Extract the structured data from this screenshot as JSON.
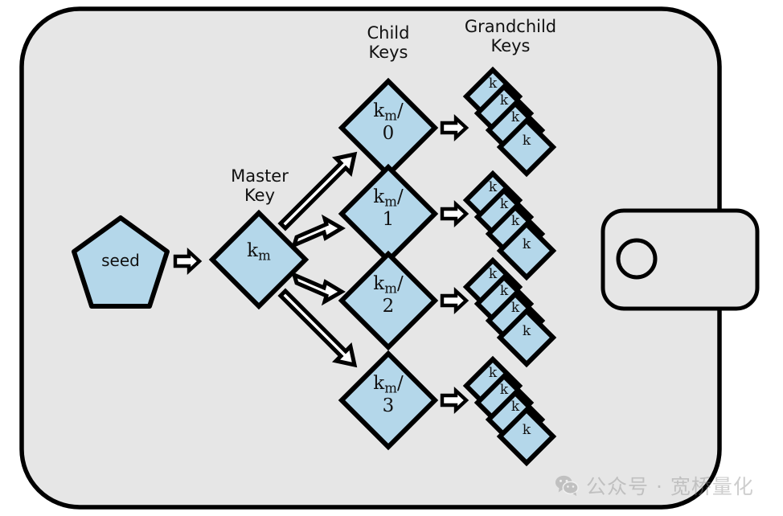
{
  "figure": {
    "background_color": "#ffffff",
    "panel_color": "#e6e6e6",
    "shape_fill": "#b4d7ea",
    "stroke_color": "#000000",
    "text_color": "#111111"
  },
  "headings": {
    "child_keys": "Child\nKeys",
    "grandchild_keys": "Grandchild\nKeys",
    "master_key": "Master\nKey"
  },
  "seed": {
    "label": "seed",
    "shape": "pentagon"
  },
  "master_key": {
    "base": "k",
    "subscript": "m",
    "shape": "diamond"
  },
  "child_keys": [
    {
      "base": "k",
      "subscript": "m",
      "suffix": "/",
      "index": "0",
      "shape": "diamond"
    },
    {
      "base": "k",
      "subscript": "m",
      "suffix": "/",
      "index": "1",
      "shape": "diamond"
    },
    {
      "base": "k",
      "subscript": "m",
      "suffix": "/",
      "index": "2",
      "shape": "diamond"
    },
    {
      "base": "k",
      "subscript": "m",
      "suffix": "/",
      "index": "3",
      "shape": "diamond"
    }
  ],
  "grandchild_stacks": [
    {
      "label": "k",
      "count": 4
    },
    {
      "label": "k",
      "count": 4
    },
    {
      "label": "k",
      "count": 4
    },
    {
      "label": "k",
      "count": 4
    }
  ],
  "arrows": {
    "seed_to_master": "block-arrow-right",
    "master_to_child": "block-arrow-diagonal",
    "child_to_grandchild": "block-arrow-right"
  },
  "side_panel": {
    "shape": "rounded-rectangle",
    "knob": "circle"
  },
  "watermark": {
    "icon": "wechat-icon",
    "text": "公众号 · 宽桥量化"
  }
}
